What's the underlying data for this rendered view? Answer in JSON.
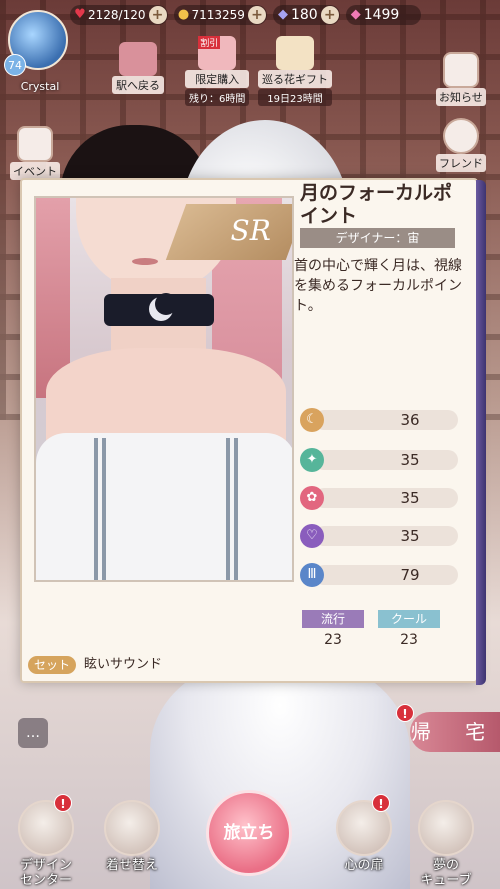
{
  "topbar": {
    "stamina": "2128/120",
    "gold": "7113259",
    "diamonds": "180",
    "pink_diamonds": "1499"
  },
  "player": {
    "level": "74",
    "name": "Crystal"
  },
  "top_icons": {
    "station_back": "駅へ戻る",
    "limited_purchase": "限定購入",
    "limited_remaining": "残り：6時間",
    "flower_gift": "巡る花ギフト",
    "flower_remaining": "19日23時間",
    "limited_tag": "割引"
  },
  "right_buttons": {
    "notice": "お知らせ",
    "friend": "フレンド"
  },
  "left_buttons": {
    "event": "イベント"
  },
  "card": {
    "rarity": "SR",
    "title": "月のフォーカルポイント",
    "designer": "デザイナー：宙",
    "description": "首の中心で輝く月は、視線を集めるフォーカルポイント。",
    "stats": [
      {
        "icon": "elegance-icon",
        "value": "36",
        "color": "#d9a35e"
      },
      {
        "icon": "fresh-icon",
        "value": "35",
        "color": "#56b59a"
      },
      {
        "icon": "sweet-icon",
        "value": "35",
        "color": "#e2667f"
      },
      {
        "icon": "sexy-icon",
        "value": "35",
        "color": "#8a5dbd"
      },
      {
        "icon": "cool-icon",
        "value": "79",
        "color": "#5a86c9"
      }
    ],
    "tags": [
      {
        "label": "流行",
        "value": "23",
        "color": "#9a7bb8"
      },
      {
        "label": "クール",
        "value": "23",
        "color": "#8ac1d0"
      }
    ],
    "set_label": "セット",
    "set_name": "眩いサウンド"
  },
  "bottom_nav": {
    "design_center": "デザイン\nセンター",
    "dress_up": "着せ替え",
    "depart": "旅立ち",
    "heart_door": "心の扉",
    "dream_cube": "夢の\nキューブ",
    "go_home": "帰 宅"
  }
}
